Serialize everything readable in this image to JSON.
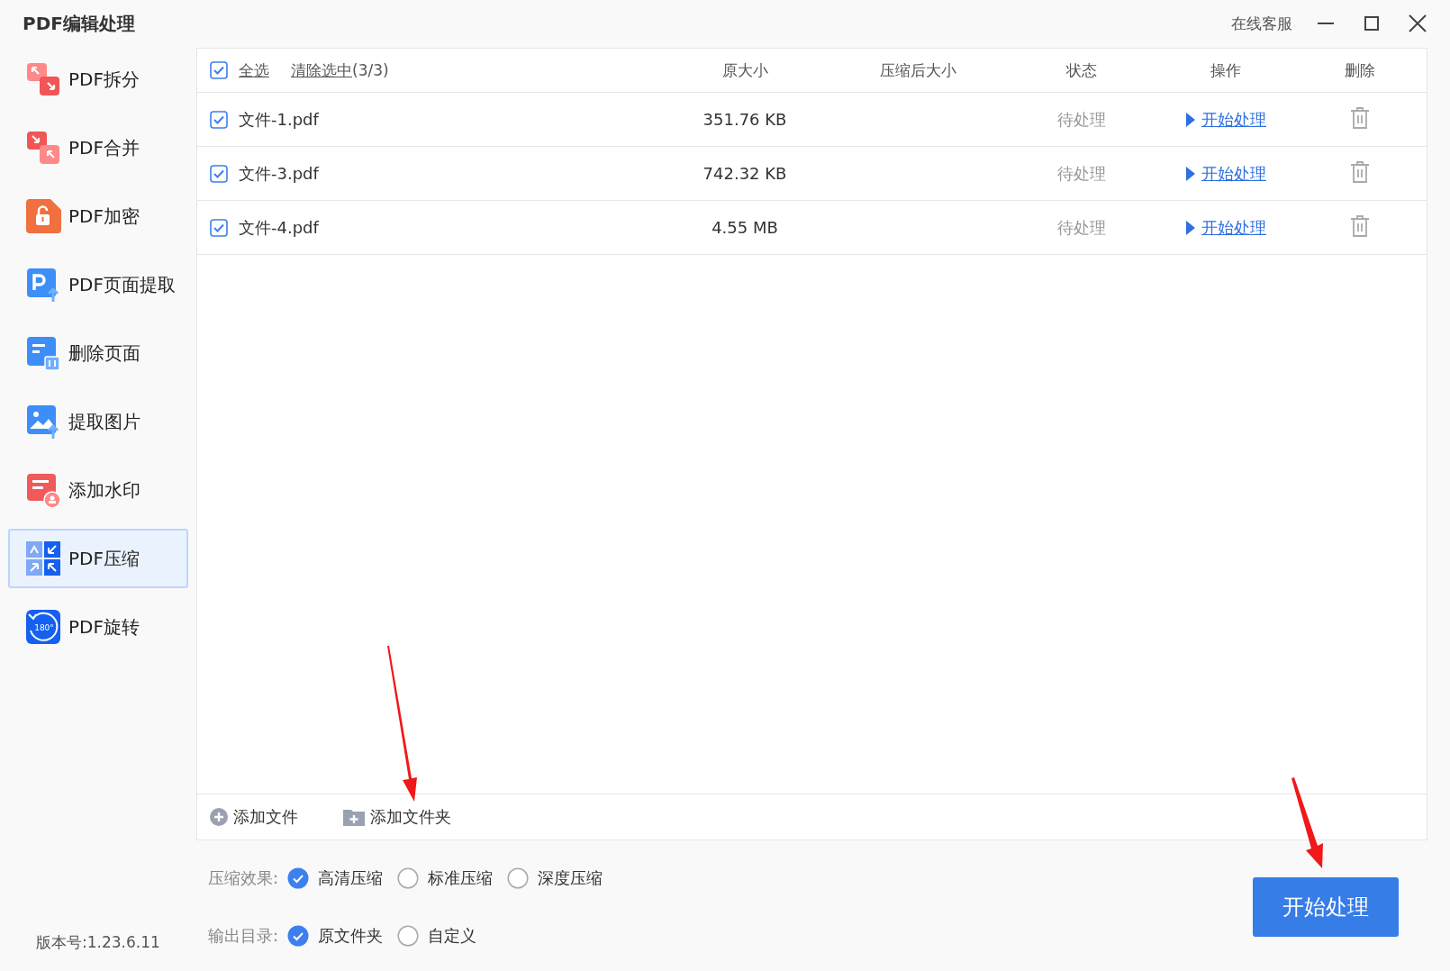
{
  "window": {
    "title": "PDF编辑处理",
    "support_link": "在线客服"
  },
  "sidebar": {
    "items": [
      {
        "label": "PDF拆分",
        "selected": false
      },
      {
        "label": "PDF合并",
        "selected": false
      },
      {
        "label": "PDF加密",
        "selected": false
      },
      {
        "label": "PDF页面提取",
        "selected": false
      },
      {
        "label": "删除页面",
        "selected": false
      },
      {
        "label": "提取图片",
        "selected": false
      },
      {
        "label": "添加水印",
        "selected": false
      },
      {
        "label": "PDF压缩",
        "selected": true
      },
      {
        "label": "PDF旋转",
        "icon_text": "180°",
        "selected": false
      }
    ]
  },
  "table": {
    "select_all": {
      "label": "全选",
      "checked": true
    },
    "clear_selection": "清除选中",
    "selection_count": "(3/3)",
    "columns": [
      "原大小",
      "压缩后大小",
      "状态",
      "操作",
      "删除"
    ],
    "rows": [
      {
        "name": "文件-1.pdf",
        "checked": true,
        "original_size": "351.76 KB",
        "status": "待处理",
        "action": "开始处理"
      },
      {
        "name": "文件-3.pdf",
        "checked": true,
        "original_size": "742.32 KB",
        "status": "待处理",
        "action": "开始处理"
      },
      {
        "name": "文件-4.pdf",
        "checked": true,
        "original_size": "4.55 MB",
        "status": "待处理",
        "action": "开始处理"
      }
    ]
  },
  "file_actions": [
    {
      "label": "添加文件",
      "kind": "file"
    },
    {
      "label": "添加文件夹",
      "kind": "folder"
    }
  ],
  "options": [
    {
      "label": "压缩效果:",
      "choices": [
        {
          "label": "高清压缩",
          "selected": true
        },
        {
          "label": "标准压缩",
          "selected": false
        },
        {
          "label": "深度压缩",
          "selected": false
        }
      ]
    },
    {
      "label": "输出目录:",
      "choices": [
        {
          "label": "原文件夹",
          "selected": true
        },
        {
          "label": "自定义",
          "selected": false
        }
      ]
    }
  ],
  "version": "版本号:1.23.6.11",
  "start_button": "开始处理"
}
